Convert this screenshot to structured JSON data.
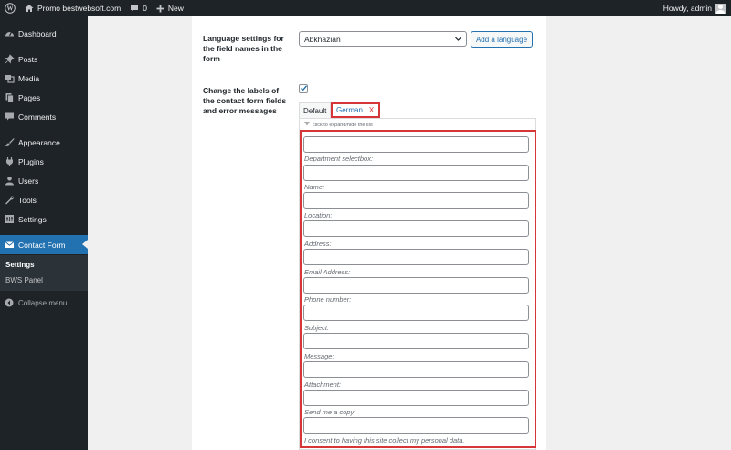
{
  "adminbar": {
    "site_name": "Promo bestwebsoft.com",
    "comments_count": "0",
    "new_label": "New",
    "greeting": "Howdy, admin"
  },
  "sidebar": {
    "items": [
      {
        "label": "Dashboard",
        "icon": "dashboard-icon"
      },
      {
        "label": "Posts",
        "icon": "pin-icon"
      },
      {
        "label": "Media",
        "icon": "media-icon"
      },
      {
        "label": "Pages",
        "icon": "pages-icon"
      },
      {
        "label": "Comments",
        "icon": "comment-icon"
      },
      {
        "label": "Appearance",
        "icon": "brush-icon"
      },
      {
        "label": "Plugins",
        "icon": "plug-icon"
      },
      {
        "label": "Users",
        "icon": "users-icon"
      },
      {
        "label": "Tools",
        "icon": "wrench-icon"
      },
      {
        "label": "Settings",
        "icon": "settings-icon"
      },
      {
        "label": "Contact Form",
        "icon": "envelope-icon"
      }
    ],
    "submenu": [
      "Settings",
      "BWS Panel"
    ],
    "collapse_label": "Collapse menu"
  },
  "settings": {
    "language_label": "Language settings for the field names in the form",
    "language_selected": "Abkhazian",
    "add_language_button": "Add a language",
    "change_labels_label": "Change the labels of the contact form fields and error messages",
    "change_labels_checked": true
  },
  "tabs": [
    {
      "label": "Default"
    },
    {
      "label": "German",
      "close": "X"
    }
  ],
  "expand_hint": "click to expand/hide the list",
  "fields": [
    "Department selectbox:",
    "Name:",
    "Location:",
    "Address:",
    "Email Address:",
    "Phone number:",
    "Subject:",
    "Message:",
    "Attachment:",
    "Send me a copy",
    "I consent to having this site collect my personal data."
  ],
  "colors": {
    "admin_dark": "#1d2327",
    "accent_blue": "#2271b1",
    "highlight_red": "#d63638"
  }
}
